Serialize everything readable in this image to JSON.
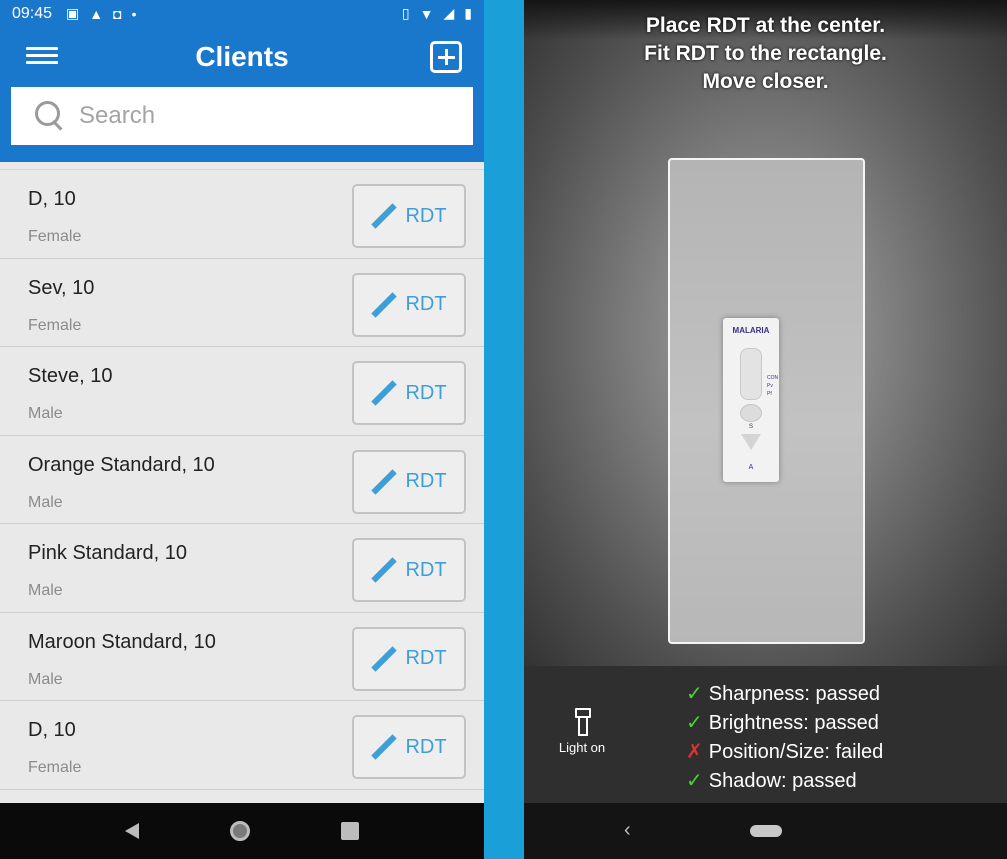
{
  "status_bar": {
    "time": "09:45",
    "notification_icons": [
      "image-icon",
      "warning-icon",
      "u-icon",
      "dot-icon"
    ],
    "system_icons": [
      "vibrate-icon",
      "wifi-icon",
      "signal-icon",
      "battery-icon"
    ]
  },
  "clients_screen": {
    "title": "Clients",
    "search": {
      "placeholder": "Search",
      "value": ""
    },
    "rdt_label": "RDT",
    "clients": [
      {
        "name": "D, 10",
        "sex": "Female"
      },
      {
        "name": "Sev, 10",
        "sex": "Female"
      },
      {
        "name": "Steve, 10",
        "sex": "Male"
      },
      {
        "name": "Orange Standard, 10",
        "sex": "Male"
      },
      {
        "name": "Pink Standard, 10",
        "sex": "Male"
      },
      {
        "name": "Maroon Standard, 10",
        "sex": "Male"
      },
      {
        "name": "D, 10",
        "sex": "Female"
      }
    ]
  },
  "camera_screen": {
    "instructions": [
      "Place RDT at the center.",
      "Fit RDT to the rectangle.",
      "Move closer."
    ],
    "light_label": "Light on",
    "cassette_label": "MALARIA",
    "checks": [
      {
        "label": "Sharpness: passed",
        "status": "passed"
      },
      {
        "label": "Brightness: passed",
        "status": "passed"
      },
      {
        "label": "Position/Size: failed",
        "status": "failed"
      },
      {
        "label": "Shadow: passed",
        "status": "passed"
      }
    ]
  },
  "colors": {
    "app_bar": "#1a78cc",
    "accent": "#3e9fd8",
    "divider_background": "#1a9fd9",
    "pass": "#4cd137",
    "fail": "#e03030"
  }
}
